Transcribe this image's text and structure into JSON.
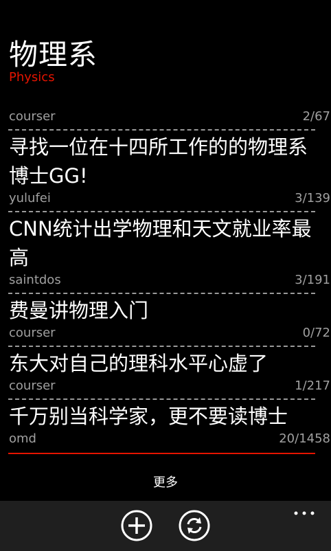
{
  "board": {
    "title": "物理系",
    "subtitle": "Physics"
  },
  "topics": [
    {
      "title": "",
      "author": "courser",
      "count": "2/67"
    },
    {
      "title": "寻找一位在十四所工作的的物理系博士GG!",
      "author": "yulufei",
      "count": "3/139"
    },
    {
      "title": "CNN统计出学物理和天文就业率最高",
      "author": "saintdos",
      "count": "3/191"
    },
    {
      "title": "费曼讲物理入门",
      "author": "courser",
      "count": "0/72"
    },
    {
      "title": "东大对自己的理科水平心虚了",
      "author": "courser",
      "count": "1/217"
    },
    {
      "title": "千万别当科学家，更不要读博士",
      "author": "omd",
      "count": "20/1458"
    }
  ],
  "more_label": "更多",
  "app_bar": {
    "buttons": [
      {
        "icon": "add-icon"
      },
      {
        "icon": "refresh-icon"
      }
    ],
    "menu_icon": "ellipsis-icon"
  },
  "colors": {
    "accent": "#e51400",
    "background": "#000000",
    "app_bar": "#1f1f1f",
    "secondary_text": "#a0a0a0"
  }
}
